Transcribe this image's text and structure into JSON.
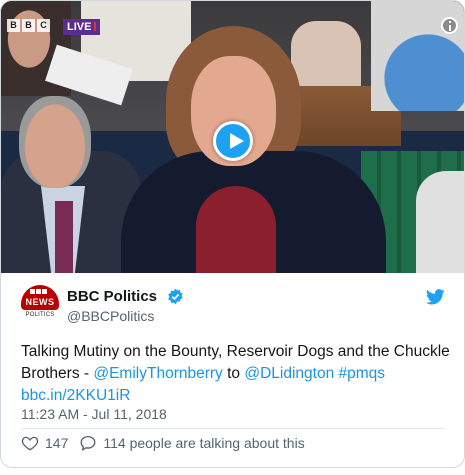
{
  "video": {
    "broadcaster_mark": [
      "B",
      "B",
      "C"
    ],
    "live_label": "LIVE"
  },
  "author": {
    "avatar_top": "NEWS",
    "avatar_bottom": "POLITICS",
    "name": "BBC Politics",
    "handle": "@BBCPolitics"
  },
  "tweet": {
    "text_before": "Talking Mutiny on the Bounty, Reservoir Dogs and the Chuckle Brothers - ",
    "mention_1": "@EmilyThornberry",
    "text_between": " to ",
    "mention_2": "@DLidington",
    "hashtag": "#pmqs",
    "link": "bbc.in/2KKU1iR",
    "timestamp": "11:23 AM - Jul 11, 2018"
  },
  "actions": {
    "like_count": "147",
    "talk_text": "114 people are talking about this"
  },
  "colors": {
    "link": "#1b95e0",
    "bbc_red": "#b80000",
    "live_purple": "#5b2d8e"
  },
  "icons": [
    "info-icon",
    "play-icon",
    "verified-icon",
    "twitter-bird-icon",
    "heart-icon",
    "reply-icon"
  ]
}
